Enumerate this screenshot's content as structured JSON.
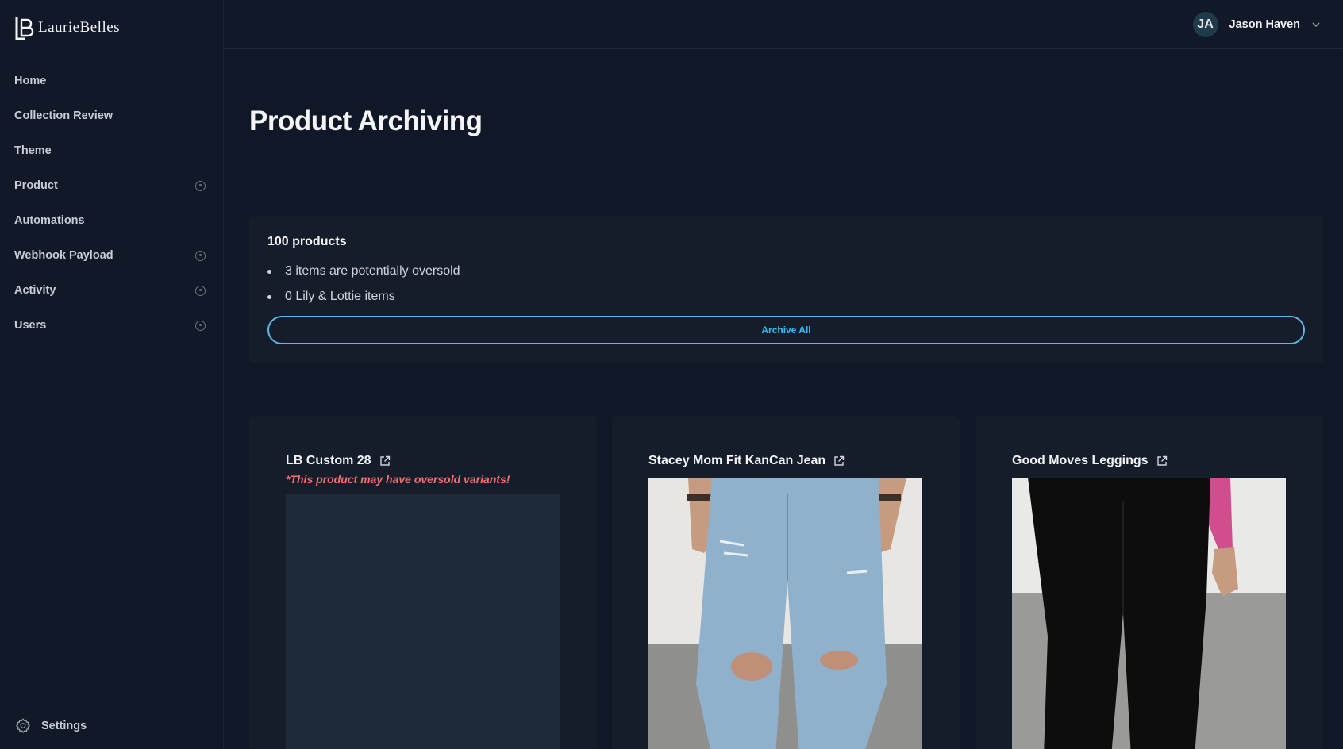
{
  "brand": {
    "logo_mark": "LB",
    "name": "LaurieBelles"
  },
  "sidebar": {
    "items": [
      {
        "label": "Home",
        "expandable": false
      },
      {
        "label": "Collection Review",
        "expandable": false
      },
      {
        "label": "Theme",
        "expandable": false
      },
      {
        "label": "Product",
        "expandable": true
      },
      {
        "label": "Automations",
        "expandable": false
      },
      {
        "label": "Webhook Payload",
        "expandable": true
      },
      {
        "label": "Activity",
        "expandable": true
      },
      {
        "label": "Users",
        "expandable": true
      }
    ],
    "settings_label": "Settings"
  },
  "header": {
    "avatar_initials": "JA",
    "user_name": "Jason Haven"
  },
  "page": {
    "title": "Product Archiving"
  },
  "summary": {
    "count_label": "100 products",
    "bullets": [
      "3 items are potentially oversold",
      "0 Lily & Lottie items"
    ],
    "archive_button_label": "Archive All"
  },
  "products": [
    {
      "name": "LB Custom 28",
      "warning": "*This product may have oversold variants!",
      "image": "placeholder"
    },
    {
      "name": "Stacey Mom Fit KanCan Jean",
      "warning": "",
      "image": "distressed-light-wash-jeans"
    },
    {
      "name": "Good Moves Leggings",
      "warning": "",
      "image": "black-leggings-pink-top"
    }
  ],
  "colors": {
    "background": "#101828",
    "sidebar": "#111827",
    "card": "#151d2b",
    "accent": "#38bdf8",
    "warning": "#f87171"
  }
}
